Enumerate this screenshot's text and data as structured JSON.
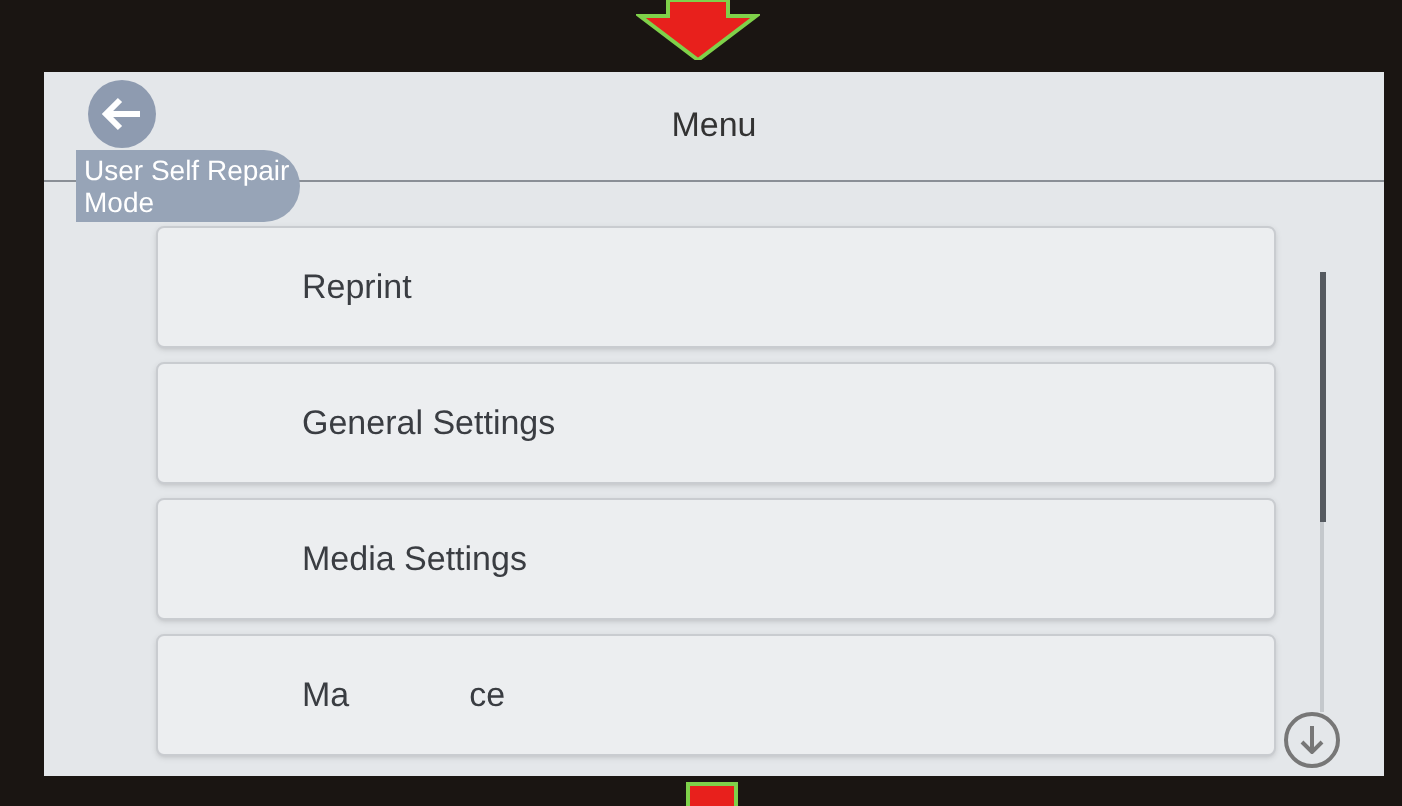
{
  "header": {
    "title": "Menu",
    "badge": "User Self Repair Mode"
  },
  "menu_items": [
    {
      "kind": "full",
      "label": "Reprint"
    },
    {
      "kind": "full",
      "label": "General Settings"
    },
    {
      "kind": "full",
      "label": "Media Settings"
    },
    {
      "kind": "obscured",
      "parts": [
        "Ma",
        "ce"
      ]
    }
  ]
}
